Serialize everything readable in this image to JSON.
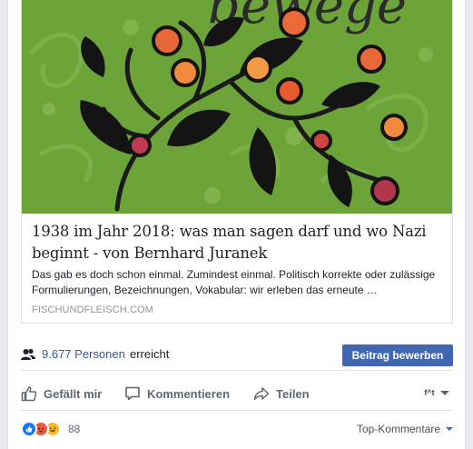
{
  "link_card": {
    "image_logo_text": "bewege",
    "title": "1938 im Jahr 2018: was man sagen darf und wo Nazi beginnt - von Bernhard Juranek",
    "description": "Das gab es doch schon einmal. Zumindest einmal. Politisch korrekte oder zulässige Formulierungen, Bezeichnungen, Vokabular: wir erleben das erneute …",
    "domain": "FISCHUNDFLEISCH.COM"
  },
  "reach": {
    "icon": "people-icon",
    "count_text": "9.677 Personen",
    "label": "erreicht",
    "promote_button": "Beitrag bewerben"
  },
  "actions": {
    "like": {
      "label": "Gefällt mir",
      "icon": "thumbs-up-icon"
    },
    "comment": {
      "label": "Kommentieren",
      "icon": "speech-bubble-icon"
    },
    "share": {
      "label": "Teilen",
      "icon": "share-arrow-icon"
    },
    "page_switch": {
      "avatar_text": "f^t",
      "icon": "chevron-down-icon"
    }
  },
  "reactions": {
    "types": [
      "like",
      "angry",
      "haha"
    ],
    "count": "88",
    "sort_label": "Top-Kommentare"
  },
  "colors": {
    "image_background": "#6da43a",
    "link_blue": "#365899",
    "button_blue": "#4267b2",
    "muted_text": "#90949c"
  }
}
